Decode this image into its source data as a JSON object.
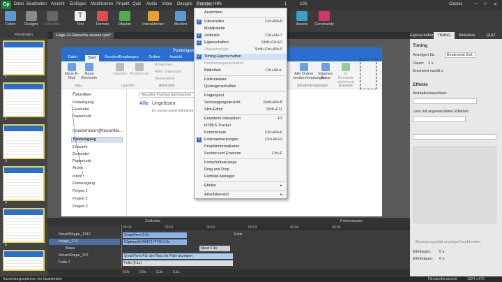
{
  "menubar": {
    "items": [
      "Datei",
      "Bearbeiten",
      "Ansicht",
      "Einfügen",
      "Modifizieren",
      "Projekt",
      "Quiz",
      "Audio",
      "Video",
      "Designs",
      "Fenster",
      "Hilfe"
    ],
    "page_num": "1",
    "page_total": "100",
    "workspace": "Classic"
  },
  "toolbar": {
    "items": [
      "Folien",
      "Designs",
      "Fold.Bld.",
      "Text",
      "Formen",
      "Objekte",
      "Interaktionen",
      "Medien",
      "Assets",
      "Community"
    ]
  },
  "filmstrip": {
    "title": "Filmstreifen",
    "numbers": [
      "1",
      "2",
      "3",
      "4",
      "5",
      "6"
    ]
  },
  "doc_tab": "Folge-22-Retusche-reusen.cptx*",
  "outlook": {
    "title": "Posteingang",
    "tabs": [
      "Datei",
      "Start",
      "Senden/Empfangen",
      "Ordner",
      "Ansicht"
    ],
    "ribbon": [
      "Neue E-Mail",
      "Neue Elemente",
      "Löschen",
      "Archivieren",
      "Antworten",
      "Allen antworten",
      "Weiterleiten"
    ],
    "groups": [
      "Neu",
      "Löschen",
      "Antworten"
    ],
    "right_buttons": [
      "Alle Ordner senden/empfangen",
      "Eigenes Konto",
      "In Evernote speichern"
    ],
    "right_groups": [
      "Senden/Empfangen",
      "Evernote"
    ],
    "search": "Aktuelles Postfach durchsuchen",
    "filter_all": "Alle",
    "filter_unread": "Ungelesen",
    "empty": "Es wurden keine Elemente gefunden.",
    "nav": [
      "Favoriten",
      "Posteingang",
      "Gesendet",
      "Papierkorb",
      "mustermann@tecwriter...",
      "Posteingang",
      "Entwürfe",
      "Gesendet",
      "Papierkorb",
      "Archiv",
      "Intern",
      "Postausgang",
      "Projekt 1",
      "Projekt 2",
      "Projekt 3"
    ]
  },
  "menu": {
    "rows": [
      {
        "label": "Ausrichten",
        "shortcut": "",
        "checked": false,
        "disabled": false
      },
      {
        "label": "Filmstreifen",
        "shortcut": "Ctrl+Alt+B",
        "checked": true,
        "disabled": false
      },
      {
        "label": "Mobilpalette",
        "shortcut": "",
        "checked": false,
        "disabled": false
      },
      {
        "label": "Zeitleiste",
        "shortcut": "Ctrl+Alt+T",
        "checked": true,
        "disabled": false
      },
      {
        "label": "Eigenschaften",
        "shortcut": "Shift+Ctrl+D",
        "checked": true,
        "disabled": false
      },
      {
        "label": "Statusanzeige",
        "shortcut": "Shift+Ctrl+Alt+P",
        "checked": false,
        "disabled": true
      },
      {
        "label": "Timing-Eigenschaften",
        "shortcut": "",
        "checked": true,
        "disabled": false,
        "highlight": true
      },
      {
        "label": "Positionseigenschaften",
        "shortcut": "",
        "checked": false,
        "disabled": true
      },
      {
        "label": "Bibliothek",
        "shortcut": "Ctrl+Alt+L",
        "checked": false,
        "disabled": false
      },
      {
        "label": "Folienmaster",
        "shortcut": "",
        "checked": false,
        "disabled": false
      },
      {
        "label": "Quizeigenschaften",
        "shortcut": "",
        "checked": false,
        "disabled": false
      },
      {
        "label": "Fragenpool",
        "shortcut": "",
        "checked": false,
        "disabled": false
      },
      {
        "label": "Verzweigungsansicht",
        "shortcut": "Shift+Alt+B",
        "checked": false,
        "disabled": false
      },
      {
        "label": "Skin-Editor",
        "shortcut": "Shift+F11",
        "checked": false,
        "disabled": false
      },
      {
        "label": "Erweiterte Interaktion",
        "shortcut": "F9",
        "checked": false,
        "disabled": false
      },
      {
        "label": "HTML5-Tracker",
        "shortcut": "",
        "checked": false,
        "disabled": false
      },
      {
        "label": "Kommentare",
        "shortcut": "Ctrl+Alt+K",
        "checked": false,
        "disabled": false
      },
      {
        "label": "Folienanmerkungen",
        "shortcut": "Ctrl+Alt+N",
        "checked": true,
        "disabled": false
      },
      {
        "label": "Projektinformationen",
        "shortcut": "",
        "checked": false,
        "disabled": false
      },
      {
        "label": "Suchen und Ersetzen",
        "shortcut": "Ctrl+F",
        "checked": false,
        "disabled": false
      },
      {
        "label": "Fortschrittsanzeige",
        "shortcut": "",
        "checked": false,
        "disabled": false
      },
      {
        "label": "Drag and Drop",
        "shortcut": "",
        "checked": false,
        "disabled": false
      },
      {
        "label": "Farbfeld-Manager",
        "shortcut": "",
        "checked": false,
        "disabled": false
      },
      {
        "label": "Effekte",
        "shortcut": "▸",
        "checked": false,
        "disabled": false
      },
      {
        "label": "Arbeitsbereich",
        "shortcut": "▸",
        "checked": false,
        "disabled": false
      }
    ],
    "separators_after": [
      0,
      8,
      10,
      13,
      19,
      22,
      23
    ]
  },
  "timeline": {
    "header": "Zeitleiste",
    "header_right": "Folienmaster",
    "rows": [
      "SmartShape_1312",
      "Image_276",
      "Maus",
      "SmartShape_767",
      "Folie 1"
    ],
    "bars": [
      "SmartForm:3.0s",
      "Clipboard149687174796:3.0s",
      "Maus:1.4s",
      "SmartForm:Für den Rest der Folie anzeigen",
      "Folie (5.1s)"
    ],
    "end_label": "Ende",
    "times": [
      "00:00",
      "00:01",
      "00:02",
      "00:03",
      "00:04",
      "00:05"
    ],
    "footer": [
      "0.0s",
      "0.0s",
      "3.3s",
      "5.1s"
    ]
  },
  "rightpanel": {
    "tabs": [
      "Eigenschaften",
      "TIMING",
      "Bibliothek",
      "QUIZ"
    ],
    "section": "Timing",
    "show_for_label": "Anzeigen für:",
    "show_for_value": "Bestimmte Zeit",
    "duration_label": "Dauer:",
    "duration_value": "3 s",
    "appear_label": "Erscheint nach:",
    "appear_value": "0 s",
    "effects_title": "Effekte",
    "anim_label": "Animationsauslöser:",
    "list_label": "Liste mit angewendeten Effekten:",
    "move_label": "Bewegungspfad anzeigen/ausblenden",
    "start_label": "Effektstart:",
    "start_value": "0 s",
    "dur2_label": "Effektdauer:",
    "dur2_value": "0 s"
  },
  "status": {
    "left": "Ausrichtungsoptionen ein-/ausblenden",
    "right": "Filmstreifenansicht",
    "size": "1024 x 672"
  }
}
